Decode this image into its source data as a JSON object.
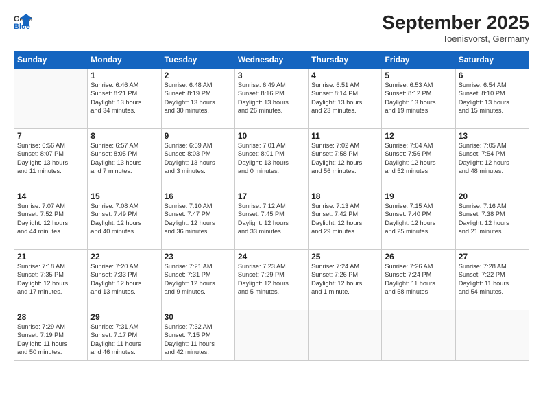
{
  "logo": {
    "line1": "General",
    "line2": "Blue"
  },
  "title": "September 2025",
  "subtitle": "Toenisvorst, Germany",
  "weekdays": [
    "Sunday",
    "Monday",
    "Tuesday",
    "Wednesday",
    "Thursday",
    "Friday",
    "Saturday"
  ],
  "weeks": [
    [
      {
        "day": "",
        "info": ""
      },
      {
        "day": "1",
        "info": "Sunrise: 6:46 AM\nSunset: 8:21 PM\nDaylight: 13 hours\nand 34 minutes."
      },
      {
        "day": "2",
        "info": "Sunrise: 6:48 AM\nSunset: 8:19 PM\nDaylight: 13 hours\nand 30 minutes."
      },
      {
        "day": "3",
        "info": "Sunrise: 6:49 AM\nSunset: 8:16 PM\nDaylight: 13 hours\nand 26 minutes."
      },
      {
        "day": "4",
        "info": "Sunrise: 6:51 AM\nSunset: 8:14 PM\nDaylight: 13 hours\nand 23 minutes."
      },
      {
        "day": "5",
        "info": "Sunrise: 6:53 AM\nSunset: 8:12 PM\nDaylight: 13 hours\nand 19 minutes."
      },
      {
        "day": "6",
        "info": "Sunrise: 6:54 AM\nSunset: 8:10 PM\nDaylight: 13 hours\nand 15 minutes."
      }
    ],
    [
      {
        "day": "7",
        "info": "Sunrise: 6:56 AM\nSunset: 8:07 PM\nDaylight: 13 hours\nand 11 minutes."
      },
      {
        "day": "8",
        "info": "Sunrise: 6:57 AM\nSunset: 8:05 PM\nDaylight: 13 hours\nand 7 minutes."
      },
      {
        "day": "9",
        "info": "Sunrise: 6:59 AM\nSunset: 8:03 PM\nDaylight: 13 hours\nand 3 minutes."
      },
      {
        "day": "10",
        "info": "Sunrise: 7:01 AM\nSunset: 8:01 PM\nDaylight: 13 hours\nand 0 minutes."
      },
      {
        "day": "11",
        "info": "Sunrise: 7:02 AM\nSunset: 7:58 PM\nDaylight: 12 hours\nand 56 minutes."
      },
      {
        "day": "12",
        "info": "Sunrise: 7:04 AM\nSunset: 7:56 PM\nDaylight: 12 hours\nand 52 minutes."
      },
      {
        "day": "13",
        "info": "Sunrise: 7:05 AM\nSunset: 7:54 PM\nDaylight: 12 hours\nand 48 minutes."
      }
    ],
    [
      {
        "day": "14",
        "info": "Sunrise: 7:07 AM\nSunset: 7:52 PM\nDaylight: 12 hours\nand 44 minutes."
      },
      {
        "day": "15",
        "info": "Sunrise: 7:08 AM\nSunset: 7:49 PM\nDaylight: 12 hours\nand 40 minutes."
      },
      {
        "day": "16",
        "info": "Sunrise: 7:10 AM\nSunset: 7:47 PM\nDaylight: 12 hours\nand 36 minutes."
      },
      {
        "day": "17",
        "info": "Sunrise: 7:12 AM\nSunset: 7:45 PM\nDaylight: 12 hours\nand 33 minutes."
      },
      {
        "day": "18",
        "info": "Sunrise: 7:13 AM\nSunset: 7:42 PM\nDaylight: 12 hours\nand 29 minutes."
      },
      {
        "day": "19",
        "info": "Sunrise: 7:15 AM\nSunset: 7:40 PM\nDaylight: 12 hours\nand 25 minutes."
      },
      {
        "day": "20",
        "info": "Sunrise: 7:16 AM\nSunset: 7:38 PM\nDaylight: 12 hours\nand 21 minutes."
      }
    ],
    [
      {
        "day": "21",
        "info": "Sunrise: 7:18 AM\nSunset: 7:35 PM\nDaylight: 12 hours\nand 17 minutes."
      },
      {
        "day": "22",
        "info": "Sunrise: 7:20 AM\nSunset: 7:33 PM\nDaylight: 12 hours\nand 13 minutes."
      },
      {
        "day": "23",
        "info": "Sunrise: 7:21 AM\nSunset: 7:31 PM\nDaylight: 12 hours\nand 9 minutes."
      },
      {
        "day": "24",
        "info": "Sunrise: 7:23 AM\nSunset: 7:29 PM\nDaylight: 12 hours\nand 5 minutes."
      },
      {
        "day": "25",
        "info": "Sunrise: 7:24 AM\nSunset: 7:26 PM\nDaylight: 12 hours\nand 1 minute."
      },
      {
        "day": "26",
        "info": "Sunrise: 7:26 AM\nSunset: 7:24 PM\nDaylight: 11 hours\nand 58 minutes."
      },
      {
        "day": "27",
        "info": "Sunrise: 7:28 AM\nSunset: 7:22 PM\nDaylight: 11 hours\nand 54 minutes."
      }
    ],
    [
      {
        "day": "28",
        "info": "Sunrise: 7:29 AM\nSunset: 7:19 PM\nDaylight: 11 hours\nand 50 minutes."
      },
      {
        "day": "29",
        "info": "Sunrise: 7:31 AM\nSunset: 7:17 PM\nDaylight: 11 hours\nand 46 minutes."
      },
      {
        "day": "30",
        "info": "Sunrise: 7:32 AM\nSunset: 7:15 PM\nDaylight: 11 hours\nand 42 minutes."
      },
      {
        "day": "",
        "info": ""
      },
      {
        "day": "",
        "info": ""
      },
      {
        "day": "",
        "info": ""
      },
      {
        "day": "",
        "info": ""
      }
    ]
  ]
}
